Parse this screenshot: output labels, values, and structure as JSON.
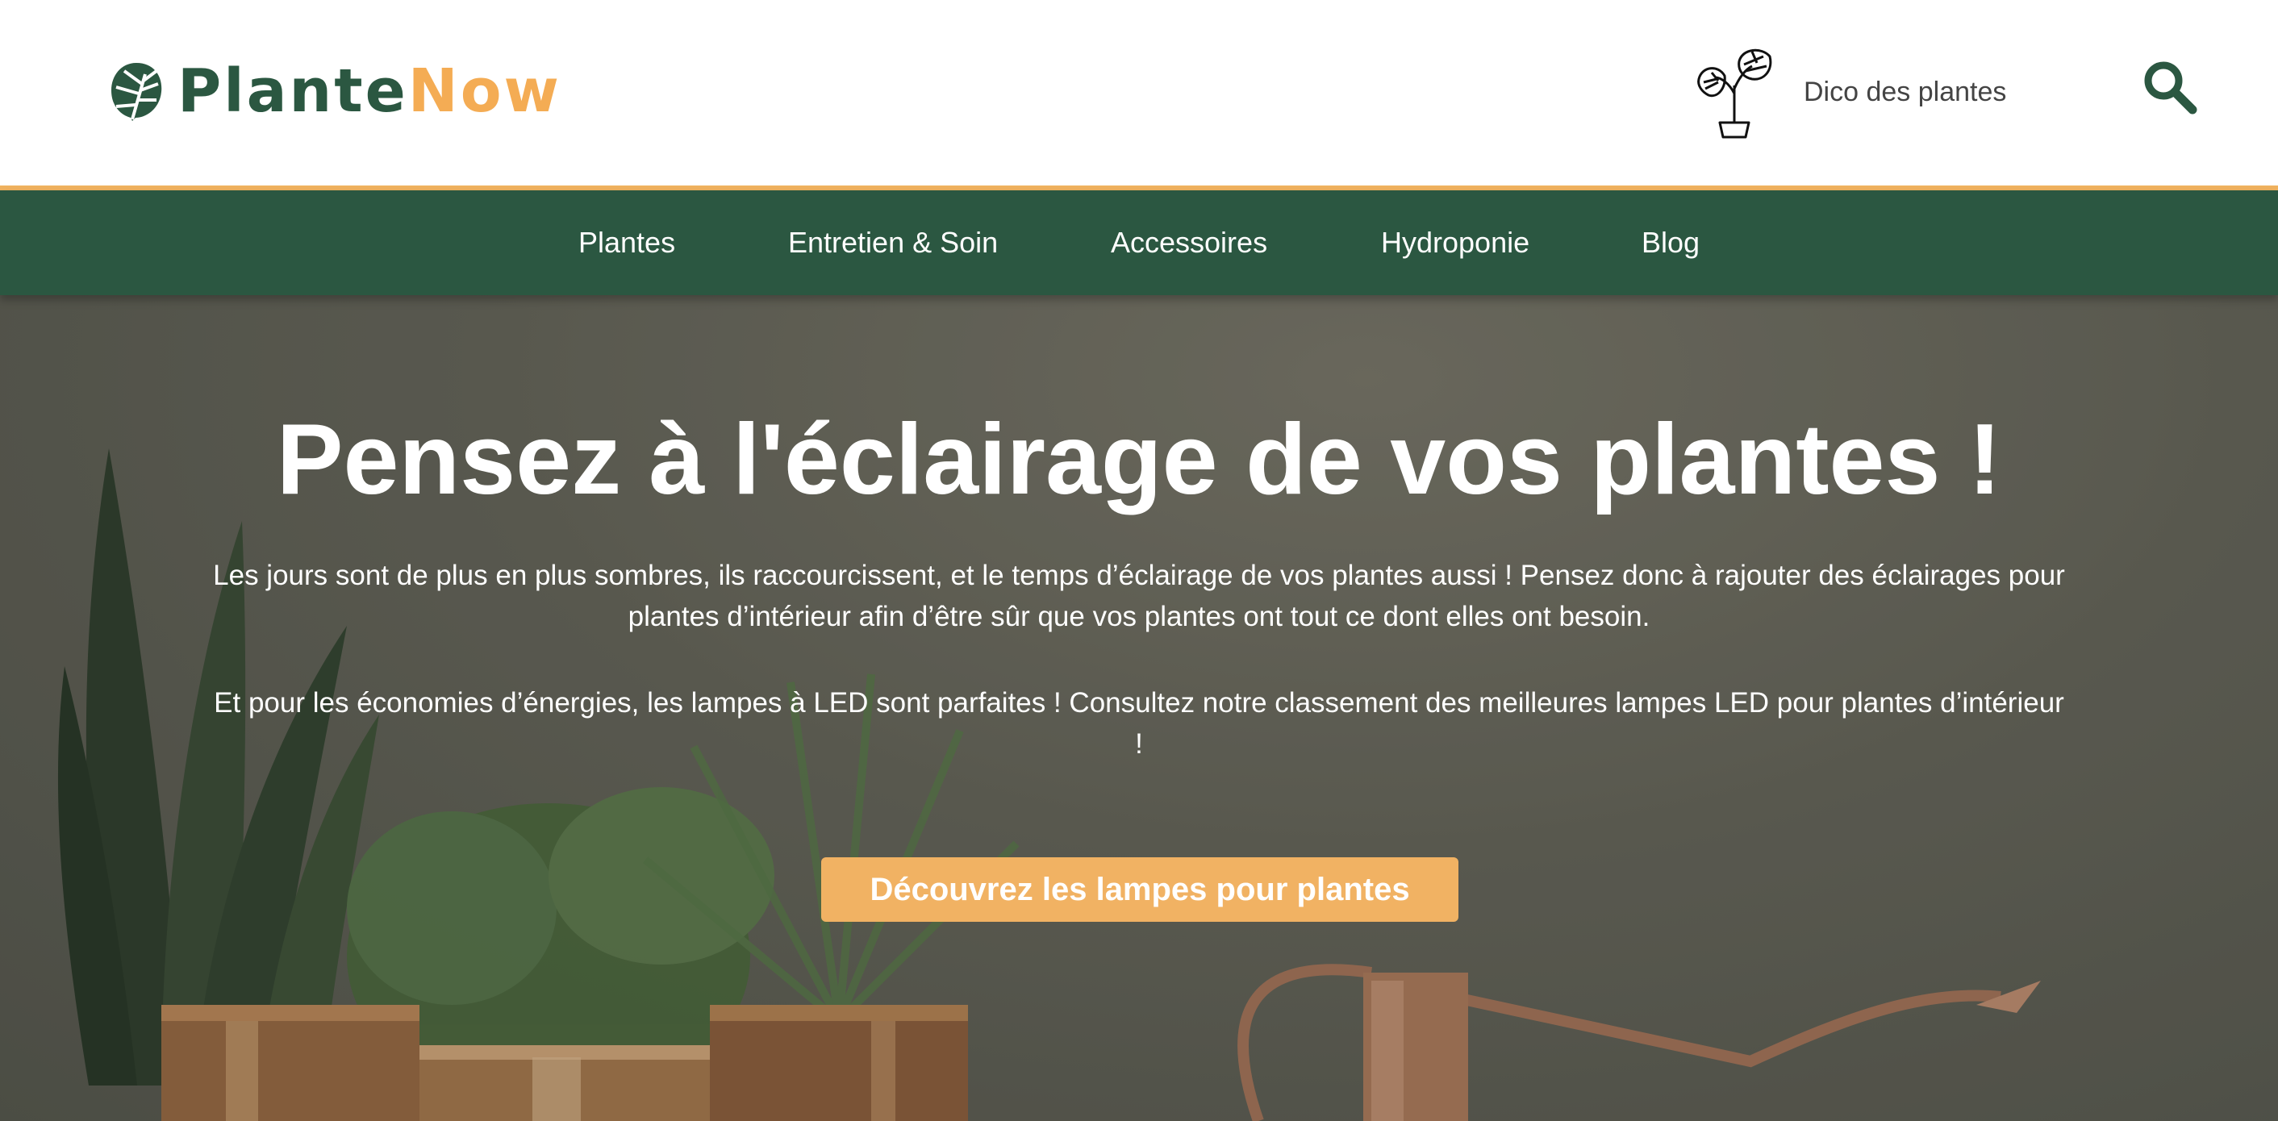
{
  "brand": {
    "name_part1": "Plante",
    "name_part2": "Now",
    "primary_color": "#2b5741",
    "accent_color": "#f4ac54"
  },
  "header": {
    "dico_label": "Dico des plantes",
    "dico_icon": "potted-monstera-icon",
    "search_icon": "search-icon"
  },
  "nav": {
    "items": [
      {
        "label": "Plantes"
      },
      {
        "label": "Entretien & Soin"
      },
      {
        "label": "Accessoires"
      },
      {
        "label": "Hydroponie"
      },
      {
        "label": "Blog"
      }
    ]
  },
  "hero": {
    "title": "Pensez à l'éclairage de vos plantes !",
    "paragraph1": "Les jours sont de plus en plus sombres, ils raccourcissent, et le temps d’éclairage de vos plantes aussi ! Pensez donc à rajouter des éclairages pour plantes d’intérieur afin d’être sûr que vos plantes ont tout ce dont elles ont besoin.",
    "paragraph2": "Et pour les économies d’énergies, les lampes à LED sont parfaites ! Consultez notre classement des meilleures lampes LED pour plantes d’intérieur !",
    "cta_label": "Découvrez les lampes pour plantes",
    "cta_color": "#f1b263"
  }
}
